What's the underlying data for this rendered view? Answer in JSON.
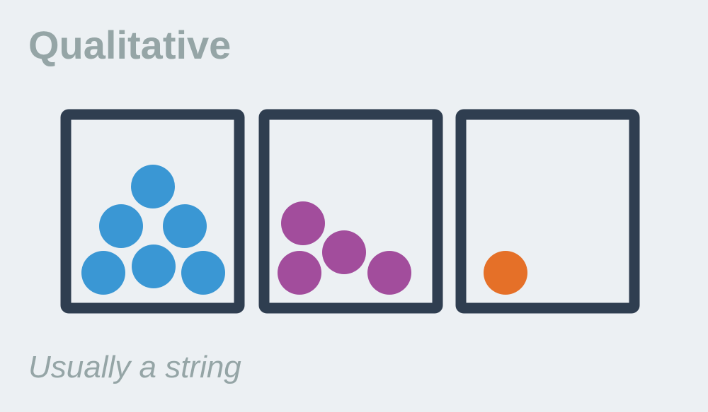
{
  "header": {
    "title": "Qualitative"
  },
  "footer": {
    "caption": "Usually a string"
  },
  "colors": {
    "background": "#ecf0f3",
    "text": "#95a5a6",
    "box_stroke": "#2f3e50"
  },
  "containers": [
    {
      "name": "container-1",
      "ball_color": "#3a97d4",
      "ball_count": 6
    },
    {
      "name": "container-2",
      "ball_color": "#a24d9c",
      "ball_count": 4
    },
    {
      "name": "container-3",
      "ball_color": "#e57028",
      "ball_count": 1
    }
  ]
}
